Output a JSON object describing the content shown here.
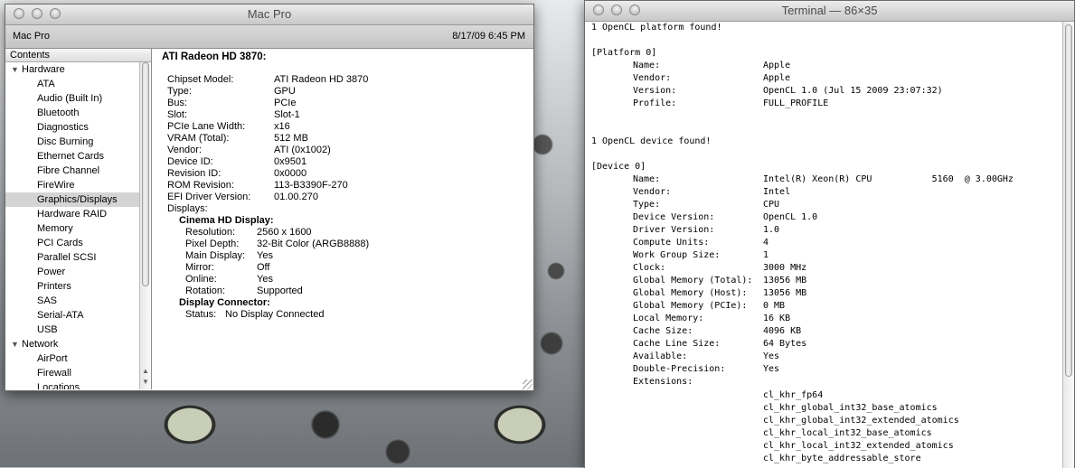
{
  "profiler": {
    "title": "Mac Pro",
    "machine": "Mac Pro",
    "date": "8/17/09 6:45 PM",
    "contents_header": "Contents",
    "tree": [
      {
        "label": "Hardware",
        "type": "group"
      },
      {
        "label": "ATA",
        "type": "item"
      },
      {
        "label": "Audio (Built In)",
        "type": "item"
      },
      {
        "label": "Bluetooth",
        "type": "item"
      },
      {
        "label": "Diagnostics",
        "type": "item"
      },
      {
        "label": "Disc Burning",
        "type": "item"
      },
      {
        "label": "Ethernet Cards",
        "type": "item"
      },
      {
        "label": "Fibre Channel",
        "type": "item"
      },
      {
        "label": "FireWire",
        "type": "item"
      },
      {
        "label": "Graphics/Displays",
        "type": "item",
        "selected": true
      },
      {
        "label": "Hardware RAID",
        "type": "item"
      },
      {
        "label": "Memory",
        "type": "item"
      },
      {
        "label": "PCI Cards",
        "type": "item"
      },
      {
        "label": "Parallel SCSI",
        "type": "item"
      },
      {
        "label": "Power",
        "type": "item"
      },
      {
        "label": "Printers",
        "type": "item"
      },
      {
        "label": "SAS",
        "type": "item"
      },
      {
        "label": "Serial-ATA",
        "type": "item"
      },
      {
        "label": "USB",
        "type": "item"
      },
      {
        "label": "Network",
        "type": "group"
      },
      {
        "label": "AirPort",
        "type": "item"
      },
      {
        "label": "Firewall",
        "type": "item"
      },
      {
        "label": "Locations",
        "type": "item"
      }
    ],
    "detail": {
      "title": "ATI Radeon HD 3870:",
      "fields": [
        {
          "k": "Chipset Model:",
          "v": "ATI Radeon HD 3870"
        },
        {
          "k": "Type:",
          "v": "GPU"
        },
        {
          "k": "Bus:",
          "v": "PCIe"
        },
        {
          "k": "Slot:",
          "v": "Slot-1"
        },
        {
          "k": "PCIe Lane Width:",
          "v": "x16"
        },
        {
          "k": "VRAM (Total):",
          "v": "512 MB"
        },
        {
          "k": "Vendor:",
          "v": "ATI (0x1002)"
        },
        {
          "k": "Device ID:",
          "v": "0x9501"
        },
        {
          "k": "Revision ID:",
          "v": "0x0000"
        },
        {
          "k": "ROM Revision:",
          "v": "113-B3390F-270"
        },
        {
          "k": "EFI Driver Version:",
          "v": "01.00.270"
        }
      ],
      "displays_label": "Displays:",
      "display_name": "Cinema HD Display:",
      "display_fields": [
        {
          "k": "Resolution:",
          "v": "2560 x 1600"
        },
        {
          "k": "Pixel Depth:",
          "v": "32-Bit Color (ARGB8888)"
        },
        {
          "k": "Main Display:",
          "v": "Yes"
        },
        {
          "k": "Mirror:",
          "v": "Off"
        },
        {
          "k": "Online:",
          "v": "Yes"
        },
        {
          "k": "Rotation:",
          "v": "Supported"
        }
      ],
      "connector_name": "Display Connector:",
      "connector_fields": [
        {
          "k": "Status:",
          "v": "No Display Connected"
        }
      ]
    }
  },
  "terminal": {
    "title": "Terminal — 86×35",
    "platform_found": "1 OpenCL platform found!",
    "platform_header": "[Platform 0]",
    "platform_fields": [
      {
        "k": "Name:",
        "v": "Apple"
      },
      {
        "k": "Vendor:",
        "v": "Apple"
      },
      {
        "k": "Version:",
        "v": "OpenCL 1.0 (Jul 15 2009 23:07:32)"
      },
      {
        "k": "Profile:",
        "v": "FULL_PROFILE"
      }
    ],
    "device_found": "1 OpenCL device found!",
    "device_header": "[Device 0]",
    "device_fields": [
      {
        "k": "Name:",
        "v": "Intel(R) Xeon(R) CPU           5160  @ 3.00GHz"
      },
      {
        "k": "Vendor:",
        "v": "Intel"
      },
      {
        "k": "Type:",
        "v": "CPU"
      },
      {
        "k": "Device Version:",
        "v": "OpenCL 1.0"
      },
      {
        "k": "Driver Version:",
        "v": "1.0"
      },
      {
        "k": "Compute Units:",
        "v": "4"
      },
      {
        "k": "Work Group Size:",
        "v": "1"
      },
      {
        "k": "Clock:",
        "v": "3000 MHz"
      },
      {
        "k": "Global Memory (Total):",
        "v": "13056 MB"
      },
      {
        "k": "Global Memory (Host):",
        "v": "13056 MB"
      },
      {
        "k": "Global Memory (PCIe):",
        "v": "0 MB"
      },
      {
        "k": "Local Memory:",
        "v": "16 KB"
      },
      {
        "k": "Cache Size:",
        "v": "4096 KB"
      },
      {
        "k": "Cache Line Size:",
        "v": "64 Bytes"
      },
      {
        "k": "Available:",
        "v": "Yes"
      },
      {
        "k": "Double-Precision:",
        "v": "Yes"
      },
      {
        "k": "Extensions:",
        "v": ""
      }
    ],
    "extensions": [
      "cl_khr_fp64",
      "cl_khr_global_int32_base_atomics",
      "cl_khr_global_int32_extended_atomics",
      "cl_khr_local_int32_base_atomics",
      "cl_khr_local_int32_extended_atomics",
      "cl_khr_byte_addressable_store"
    ]
  }
}
